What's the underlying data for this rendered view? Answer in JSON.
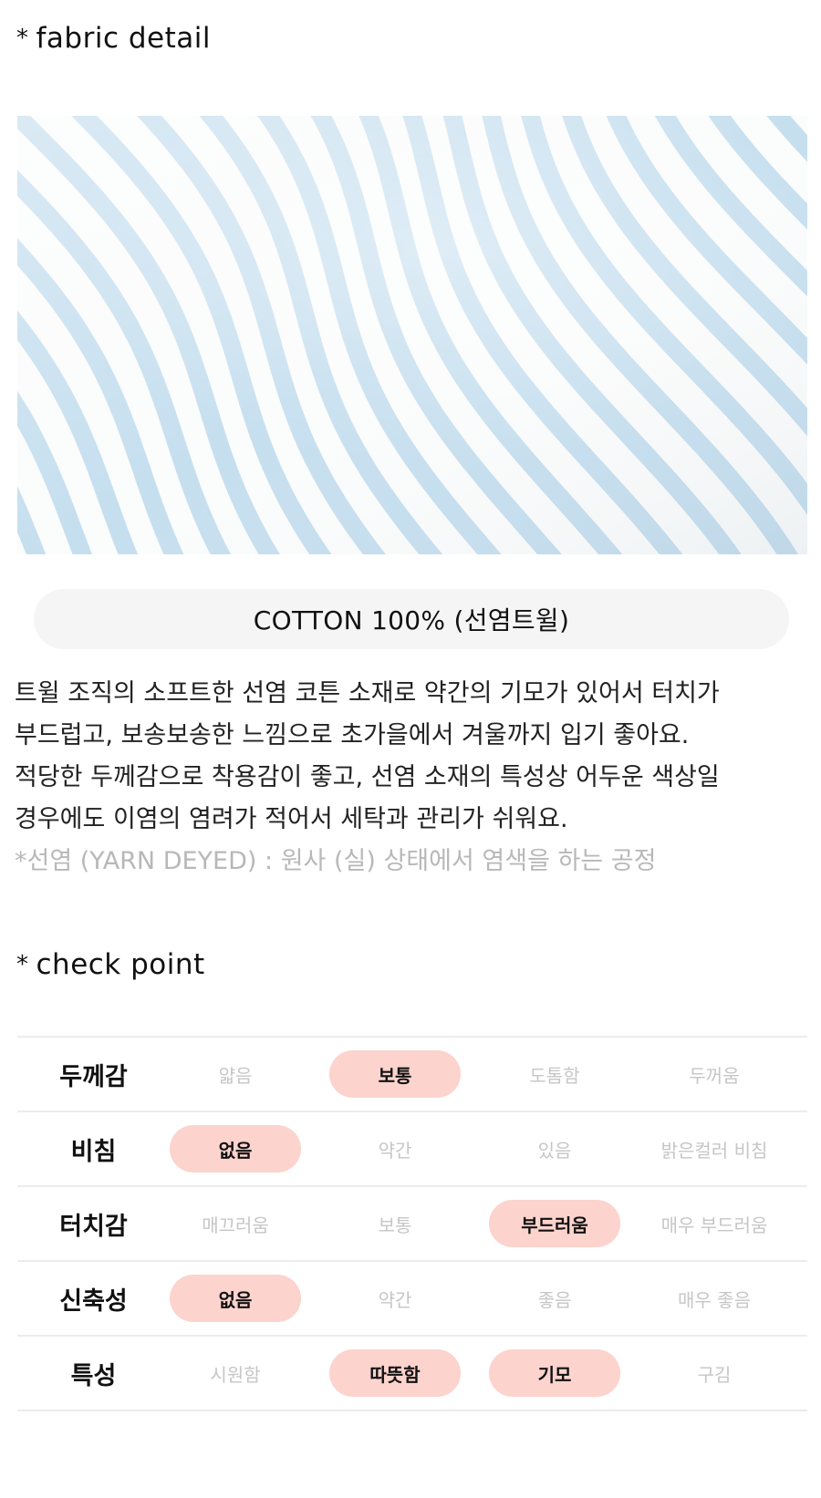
{
  "fabric_detail": {
    "heading_marker": "*",
    "heading": "fabric detail",
    "photo": {
      "subject": "light blue and white striped twill cotton fabric",
      "stripe_color": "#bcd9ec",
      "base_color": "#fbfcfc"
    },
    "material": "COTTON 100% (선염트윌)",
    "description_lines": [
      "트윌 조직의 소프트한 선염 코튼 소재로 약간의 기모가 있어서 터치가",
      "부드럽고, 보송보송한 느낌으로 초가을에서 겨울까지 입기 좋아요.",
      "적당한 두께감으로 착용감이 좋고, 선염 소재의 특성상 어두운 색상일",
      "경우에도 이염의 염려가 적어서 세탁과 관리가 쉬워요."
    ],
    "note": "*선염 (YARN DEYED) : 원사 (실) 상태에서 염색을 하는 공정"
  },
  "check_point": {
    "heading_marker": "*",
    "heading": "check point",
    "highlight_color": "#fcd3cd",
    "rows": [
      {
        "label": "두께감",
        "options": [
          {
            "text": "얇음",
            "selected": false
          },
          {
            "text": "보통",
            "selected": true
          },
          {
            "text": "도톰함",
            "selected": false
          },
          {
            "text": "두꺼움",
            "selected": false
          }
        ]
      },
      {
        "label": "비침",
        "options": [
          {
            "text": "없음",
            "selected": true
          },
          {
            "text": "약간",
            "selected": false
          },
          {
            "text": "있음",
            "selected": false
          },
          {
            "text": "밝은컬러 비침",
            "selected": false
          }
        ]
      },
      {
        "label": "터치감",
        "options": [
          {
            "text": "매끄러움",
            "selected": false
          },
          {
            "text": "보통",
            "selected": false
          },
          {
            "text": "부드러움",
            "selected": true
          },
          {
            "text": "매우 부드러움",
            "selected": false
          }
        ]
      },
      {
        "label": "신축성",
        "options": [
          {
            "text": "없음",
            "selected": true
          },
          {
            "text": "약간",
            "selected": false
          },
          {
            "text": "좋음",
            "selected": false
          },
          {
            "text": "매우 좋음",
            "selected": false
          }
        ]
      },
      {
        "label": "특성",
        "options": [
          {
            "text": "시원함",
            "selected": false
          },
          {
            "text": "따뜻함",
            "selected": true
          },
          {
            "text": "기모",
            "selected": true
          },
          {
            "text": "구김",
            "selected": false
          }
        ]
      }
    ]
  }
}
